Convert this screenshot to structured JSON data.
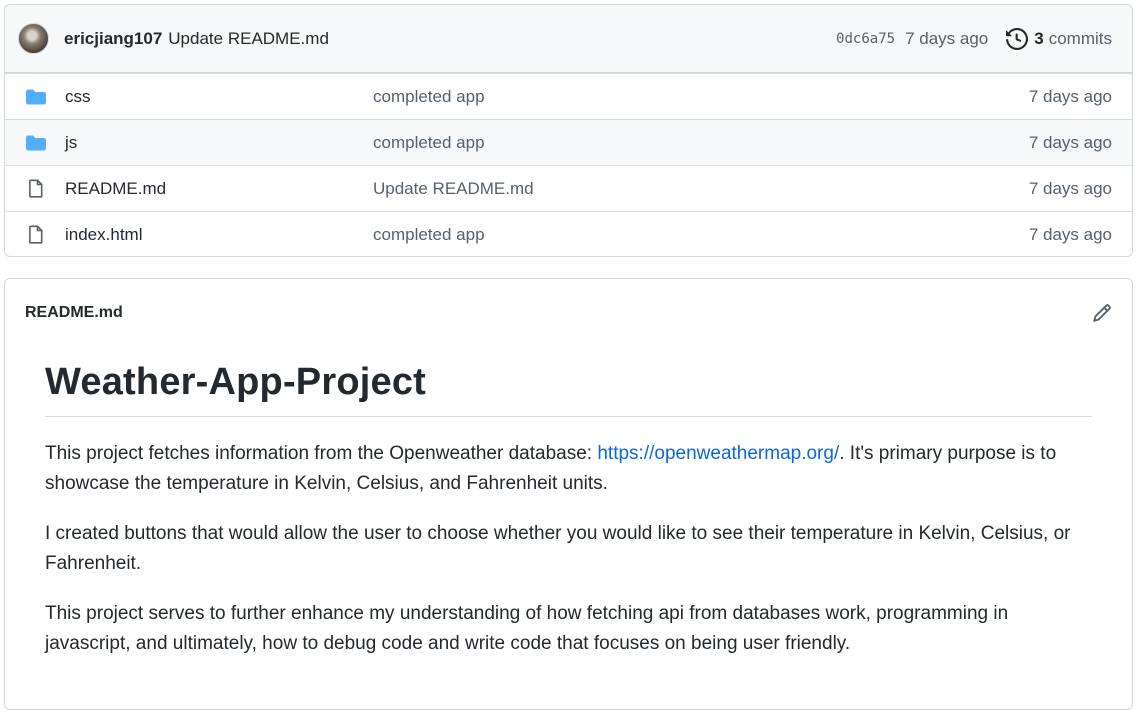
{
  "commit": {
    "author": "ericjiang107",
    "message": "Update README.md",
    "sha": "0dc6a75",
    "time": "7 days ago",
    "commit_count": "3",
    "commits_label": "commits"
  },
  "files": [
    {
      "name": "css",
      "type": "folder",
      "message": "completed app",
      "time": "7 days ago"
    },
    {
      "name": "js",
      "type": "folder",
      "message": "completed app",
      "time": "7 days ago"
    },
    {
      "name": "README.md",
      "type": "file",
      "message": "Update README.md",
      "time": "7 days ago"
    },
    {
      "name": "index.html",
      "type": "file",
      "message": "completed app",
      "time": "7 days ago"
    }
  ],
  "readme": {
    "filename": "README.md",
    "heading": "Weather-App-Project",
    "p1_before": "This project fetches information from the Openweather database: ",
    "p1_link": "https://openweathermap.org/",
    "p1_after": ". It's primary purpose is to showcase the temperature in Kelvin, Celsius, and Fahrenheit units.",
    "p2": "I created buttons that would allow the user to choose whether you would like to see their temperature in Kelvin, Celsius, or Fahrenheit.",
    "p3": "This project serves to further enhance my understanding of how fetching api from databases work, programming in javascript, and ultimately, how to debug code and write code that focuses on being user friendly."
  },
  "icons": {
    "folder": "folder-icon",
    "file": "file-icon",
    "history": "history-icon",
    "edit": "pencil-icon"
  },
  "colors": {
    "folder": "#54aeff",
    "link": "#0969da",
    "muted": "#57606a"
  }
}
